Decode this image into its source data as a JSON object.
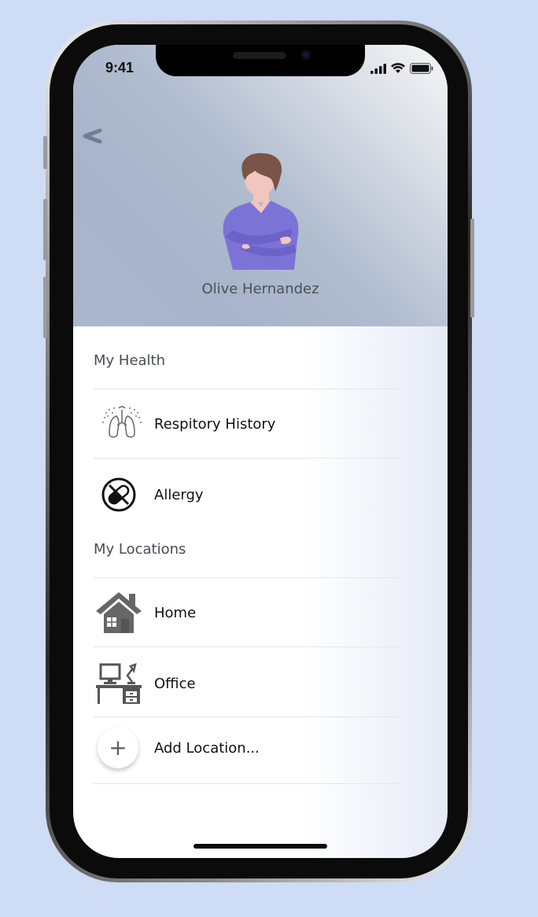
{
  "status_bar": {
    "time": "9:41"
  },
  "profile": {
    "name": "Olive Hernandez"
  },
  "sections": {
    "health": {
      "title": "My Health",
      "items": [
        {
          "label": "Respitory History",
          "icon": "lungs-icon"
        },
        {
          "label": "Allergy",
          "icon": "no-pill-icon"
        }
      ]
    },
    "locations": {
      "title": "My Locations",
      "items": [
        {
          "label": "Home",
          "icon": "house-icon"
        },
        {
          "label": "Office",
          "icon": "desk-icon"
        }
      ],
      "add_label": "Add Location...",
      "add_symbol": "+"
    }
  },
  "colors": {
    "background": "#cfdcf5",
    "avatar_shirt": "#7b73d6",
    "avatar_hair": "#7a5446",
    "avatar_skin": "#f2c6bf",
    "icon_gray": "#666666"
  }
}
